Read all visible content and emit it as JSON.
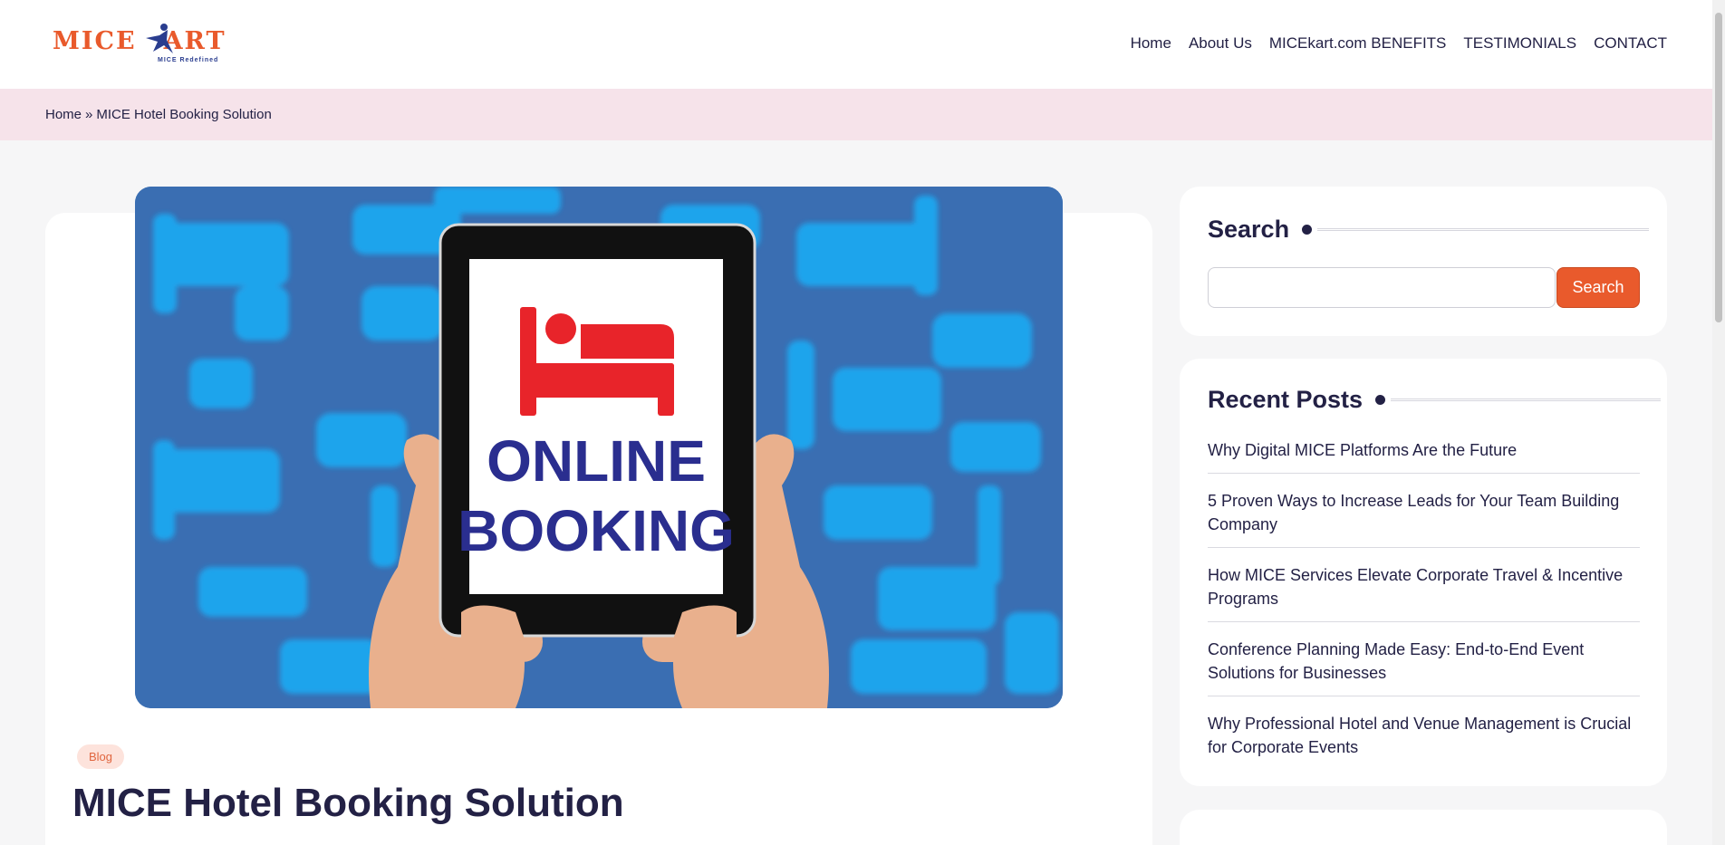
{
  "header": {
    "logo_text": "MICE",
    "logo_text_2": "ART",
    "logo_tagline": "MICE Redefined",
    "nav": [
      "Home",
      "About Us",
      "MICEkart.com BENEFITS",
      "TESTIMONIALS",
      "CONTACT"
    ]
  },
  "breadcrumb": {
    "home": "Home",
    "separator": "»",
    "current": "MICE Hotel Booking Solution"
  },
  "post": {
    "hero_text_1": "ONLINE",
    "hero_text_2": "BOOKING",
    "category": "Blog",
    "title": "MICE Hotel Booking Solution"
  },
  "sidebar": {
    "search_title": "Search",
    "search_button": "Search",
    "search_value": "",
    "recent_title": "Recent Posts",
    "recent_posts": [
      "Why Digital MICE Platforms Are the Future",
      "5 Proven Ways to Increase Leads for Your Team Building Company",
      "How MICE Services Elevate Corporate Travel & Incentive Programs",
      "Conference Planning Made Easy: End-to-End Event Solutions for Businesses",
      "Why Professional Hotel and Venue Management is Crucial for Corporate Events"
    ]
  },
  "colors": {
    "brand_orange": "#e95a2c",
    "navy_text": "#232145",
    "breadcrumb_bg": "#f6e3ea",
    "hero_bg": "#3a6eb2",
    "bed_red": "#e8242a"
  },
  "icons": [
    "logo-star-icon",
    "bed-icon"
  ]
}
